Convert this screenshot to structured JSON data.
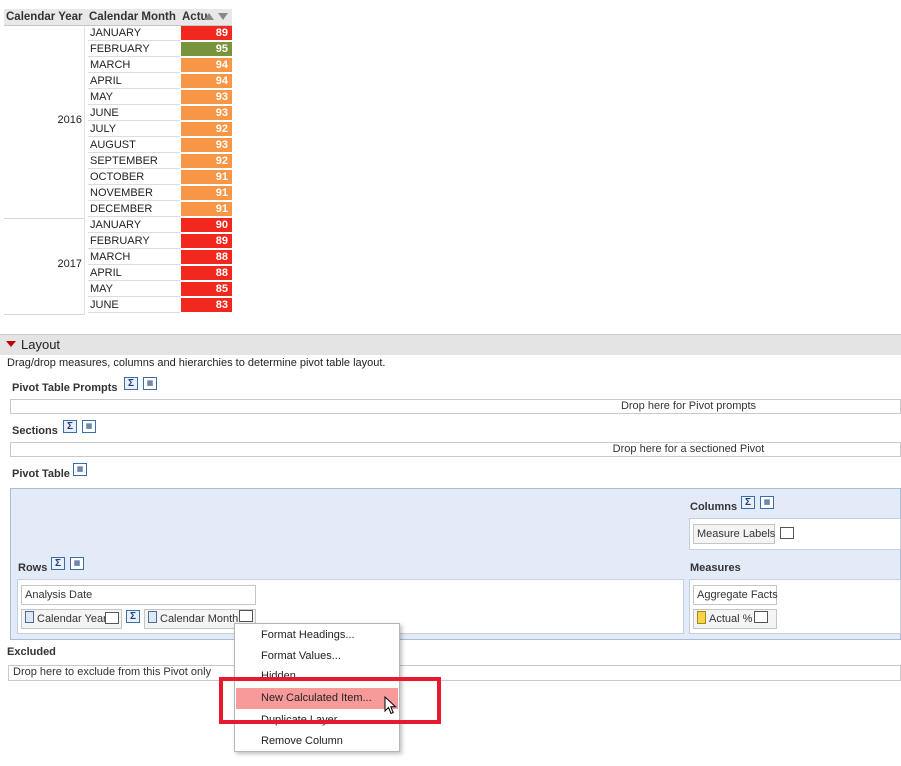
{
  "pivot": {
    "headers": {
      "year": "Calendar Year",
      "month": "Calendar Month",
      "measure": "Actu"
    },
    "colors": {
      "red": "#f2281e",
      "orange": "#f79646",
      "green": "#77933c"
    },
    "years": [
      {
        "label": "2016",
        "rows": [
          {
            "month": "JANUARY",
            "value": "89",
            "status": "red"
          },
          {
            "month": "FEBRUARY",
            "value": "95",
            "status": "green"
          },
          {
            "month": "MARCH",
            "value": "94",
            "status": "orange"
          },
          {
            "month": "APRIL",
            "value": "94",
            "status": "orange"
          },
          {
            "month": "MAY",
            "value": "93",
            "status": "orange"
          },
          {
            "month": "JUNE",
            "value": "93",
            "status": "orange"
          },
          {
            "month": "JULY",
            "value": "92",
            "status": "orange"
          },
          {
            "month": "AUGUST",
            "value": "93",
            "status": "orange"
          },
          {
            "month": "SEPTEMBER",
            "value": "92",
            "status": "orange"
          },
          {
            "month": "OCTOBER",
            "value": "91",
            "status": "orange"
          },
          {
            "month": "NOVEMBER",
            "value": "91",
            "status": "orange"
          },
          {
            "month": "DECEMBER",
            "value": "91",
            "status": "orange"
          }
        ]
      },
      {
        "label": "2017",
        "rows": [
          {
            "month": "JANUARY",
            "value": "90",
            "status": "red"
          },
          {
            "month": "FEBRUARY",
            "value": "89",
            "status": "red"
          },
          {
            "month": "MARCH",
            "value": "88",
            "status": "red"
          },
          {
            "month": "APRIL",
            "value": "88",
            "status": "red"
          },
          {
            "month": "MAY",
            "value": "85",
            "status": "red"
          },
          {
            "month": "JUNE",
            "value": "83",
            "status": "red"
          }
        ]
      }
    ]
  },
  "layout": {
    "title": "Layout",
    "description": "Drag/drop measures, columns and hierarchies to determine pivot table layout.",
    "pivot_prompts": {
      "label": "Pivot Table Prompts",
      "drop_text": "Drop here for Pivot prompts"
    },
    "sections": {
      "label": "Sections",
      "drop_text": "Drop here for a sectioned Pivot"
    },
    "pivot_table": {
      "label": "Pivot Table",
      "columns_label": "Columns",
      "columns_field": "Measure Labels",
      "rows_label": "Rows",
      "rows_folder": "Analysis Date",
      "row_fields": [
        "Calendar Year",
        "Calendar Month"
      ],
      "measures_label": "Measures",
      "measures_folder": "Aggregate Facts",
      "measure_field": "Actual %"
    },
    "excluded": {
      "label": "Excluded",
      "drop_text": "Drop here to exclude from this Pivot only"
    }
  },
  "icons": {
    "sigma": "Σ"
  },
  "context_menu": {
    "items": [
      "Format Headings...",
      "Format Values...",
      "Hidden",
      "New Calculated Item...",
      "Duplicate Layer",
      "Remove Column"
    ],
    "highlighted": "New Calculated Item..."
  }
}
